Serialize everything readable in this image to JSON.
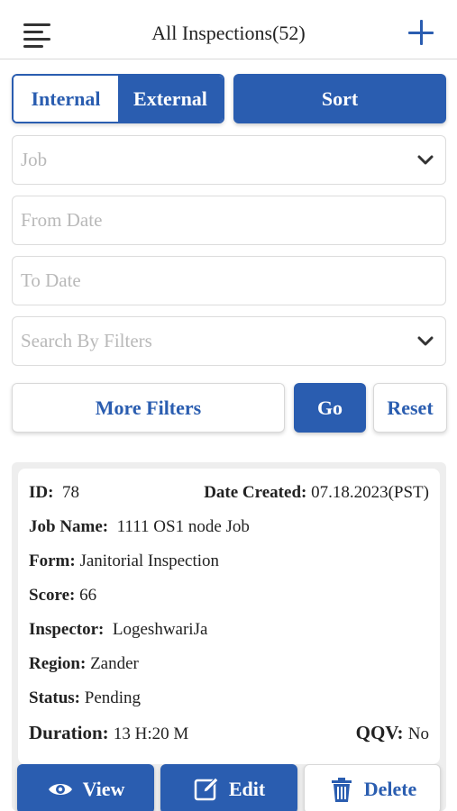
{
  "header": {
    "title": "All Inspections(52)",
    "menu_icon": "hamburger-menu-icon",
    "add_icon": "plus-icon"
  },
  "segment": {
    "internal_label": "Internal",
    "external_label": "External",
    "active": "Internal"
  },
  "sort_label": "Sort",
  "filters": {
    "job_placeholder": "Job",
    "from_date_placeholder": "From Date",
    "to_date_placeholder": "To Date",
    "search_placeholder": "Search By Filters"
  },
  "actions": {
    "more_filters_label": "More Filters",
    "go_label": "Go",
    "reset_label": "Reset"
  },
  "inspection": {
    "id_label": "ID:",
    "id": "78",
    "date_created_label": "Date Created:",
    "date_created": "07.18.2023(PST)",
    "job_name_label": "Job Name:",
    "job_name": "1111 OS1 node Job",
    "form_label": "Form:",
    "form": "Janitorial Inspection",
    "score_label": "Score:",
    "score": "66",
    "inspector_label": "Inspector:",
    "inspector": "LogeshwariJa",
    "region_label": "Region:",
    "region": "Zander",
    "status_label": "Status:",
    "status": "Pending",
    "duration_label": "Duration:",
    "duration": "13 H:20 M",
    "qqv_label": "QQV:",
    "qqv": "No"
  },
  "card_actions": {
    "view_label": "View",
    "edit_label": "Edit",
    "delete_label": "Delete"
  },
  "colors": {
    "primary": "#2a5db0",
    "border": "#dcdcdc",
    "placeholder": "#b9b9b9"
  }
}
